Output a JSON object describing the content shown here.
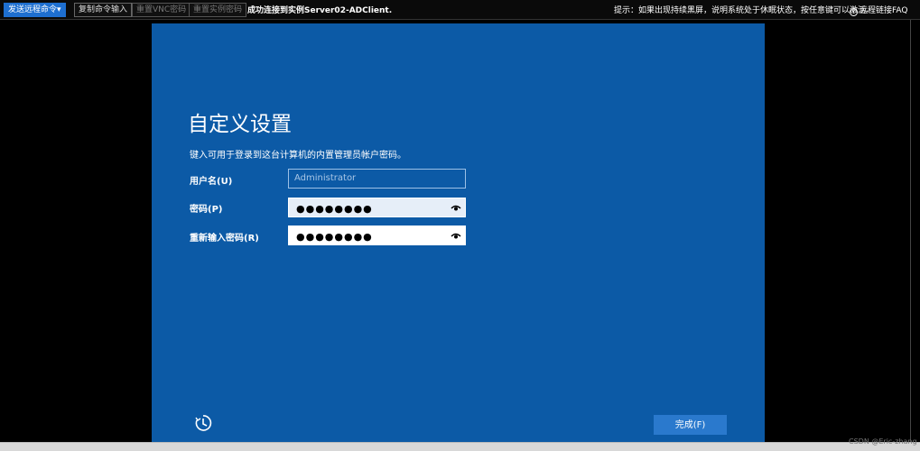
{
  "toolbar": {
    "send_command": "发送远程命令▾",
    "copy_input": "复制命令输入",
    "reset_vnc": "重置VNC密码",
    "reset_instance": "重置实例密码",
    "status": "成功连接到实例Server02-ADClient.",
    "hint": "提示：如果出现持续黑屏，说明系统处于休眠状态，按任意键可以激活。",
    "faq": "远程链接FAQ"
  },
  "remote": {
    "title": "自定义设置",
    "subtitle": "键入可用于登录到这台计算机的内置管理员帐户密码。",
    "username_label": "用户名(U)",
    "username_placeholder": "Administrator",
    "password_label": "密码(P)",
    "password_value": "●●●●●●●●",
    "reenter_label": "重新输入密码(R)",
    "reenter_value": "●●●●●●●●",
    "finish": "完成(F)"
  },
  "watermark": "CSDN @Eric-zhang",
  "colors": {
    "remote_bg": "#0c5aa6",
    "button_bg": "#2a79cd",
    "toolbar_primary": "#1e6fd0"
  }
}
